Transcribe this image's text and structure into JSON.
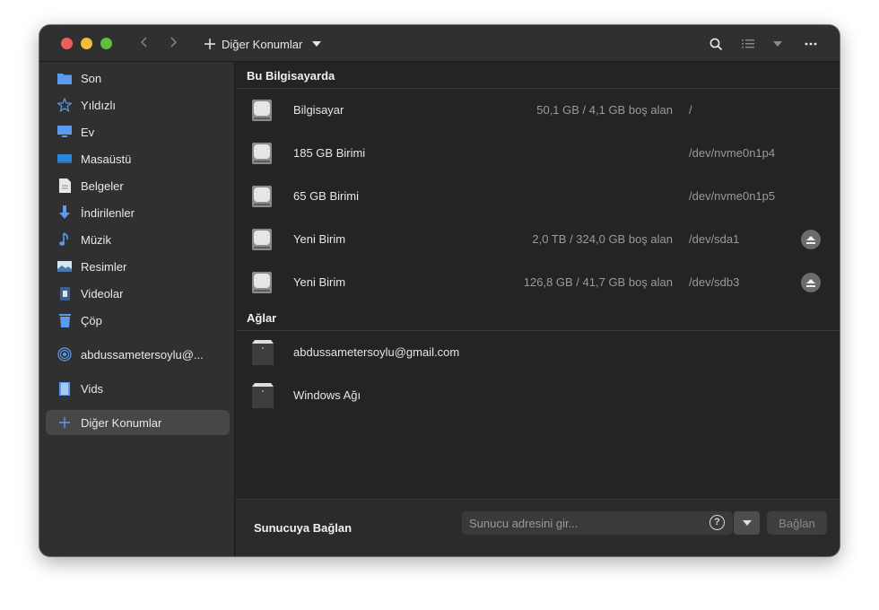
{
  "titlebar": {
    "location_label": "Diğer Konumlar",
    "icons": [
      "back-icon",
      "forward-icon",
      "plus-icon",
      "search-icon",
      "list-view-icon",
      "view-menu-icon",
      "more-icon"
    ]
  },
  "sidebar": {
    "items": [
      {
        "label": "Son",
        "icon": "folder-recent-icon"
      },
      {
        "label": "Yıldızlı",
        "icon": "star-icon"
      },
      {
        "label": "Ev",
        "icon": "home-icon"
      },
      {
        "label": "Masaüstü",
        "icon": "desktop-icon"
      },
      {
        "label": "Belgeler",
        "icon": "documents-icon"
      },
      {
        "label": "İndirilenler",
        "icon": "downloads-icon"
      },
      {
        "label": "Müzik",
        "icon": "music-icon"
      },
      {
        "label": "Resimler",
        "icon": "pictures-icon"
      },
      {
        "label": "Videolar",
        "icon": "videos-icon"
      },
      {
        "label": "Çöp",
        "icon": "trash-icon"
      },
      {
        "label": "abdussametersoylu@...",
        "icon": "network-account-icon"
      },
      {
        "label": "Vids",
        "icon": "bookmark-folder-icon"
      },
      {
        "label": "Diğer Konumlar",
        "icon": "plus-icon",
        "selected": true
      }
    ]
  },
  "main": {
    "computer_section": {
      "title": "Bu Bilgisayarda",
      "rows": [
        {
          "name": "Bilgisayar",
          "space": "50,1 GB / 4,1 GB boş alan",
          "device": "/",
          "eject": false
        },
        {
          "name": "185 GB Birimi",
          "space": "",
          "device": "/dev/nvme0n1p4",
          "eject": false
        },
        {
          "name": "65 GB Birimi",
          "space": "",
          "device": "/dev/nvme0n1p5",
          "eject": false
        },
        {
          "name": "Yeni Birim",
          "space": "2,0 TB / 324,0 GB boş alan",
          "device": "/dev/sda1",
          "eject": true
        },
        {
          "name": "Yeni Birim",
          "space": "126,8 GB / 41,7 GB boş alan",
          "device": "/dev/sdb3",
          "eject": true
        }
      ]
    },
    "network_section": {
      "title": "Ağlar",
      "rows": [
        {
          "name": "abdussametersoylu@gmail.com"
        },
        {
          "name": "Windows Ağı"
        }
      ]
    }
  },
  "footer": {
    "title": "Sunucuya Bağlan",
    "input_placeholder": "Sunucu adresini gir...",
    "input_value": "",
    "help_label": "?",
    "connect_label": "Bağlan"
  },
  "colors": {
    "window_bg": "#242424",
    "sidebar_bg": "#303030",
    "accent_blue": "#5a9bf0",
    "traffic_close": "#ec5f5d",
    "traffic_min": "#f2bc3a",
    "traffic_max": "#5fbe3f"
  }
}
